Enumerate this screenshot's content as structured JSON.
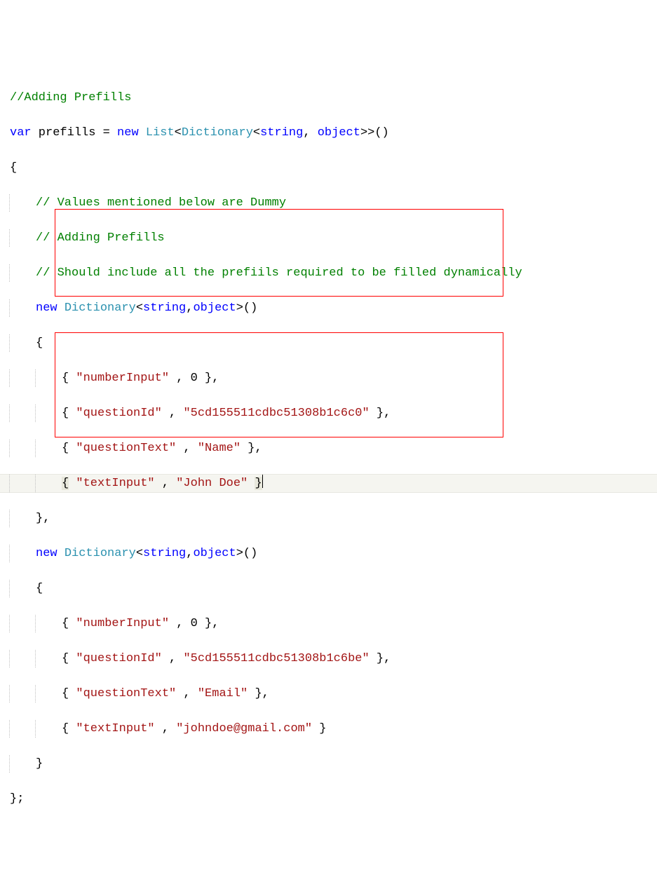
{
  "code": {
    "comment_top": "//Adding Prefills",
    "decl": {
      "var_kw": "var",
      "var_name": " prefills ",
      "eq": "=",
      "new_kw": " new ",
      "list_type": "List",
      "lt1": "<",
      "dict_type": "Dictionary",
      "lt2": "<",
      "string_kw_a": "string",
      "comma_a": ", ",
      "object_kw_a": "object",
      "gt2": ">>()"
    },
    "open_brace": "{",
    "close_brace": "};",
    "inner_comments": [
      "// Values mentioned below are Dummy",
      "// Adding Prefills",
      "// Should include all the prefiils required to be filled dynamically"
    ],
    "dict_ctor": {
      "new_kw": "new ",
      "dict_type": "Dictionary",
      "lt": "<",
      "string_kw": "string",
      "comma": ",",
      "object_kw": "object",
      "gt": ">()"
    },
    "block1": {
      "open": "{",
      "close": "},",
      "rows": [
        {
          "key": "\"numberInput\"",
          "sep": " , ",
          "val": "0",
          "after": " },"
        },
        {
          "key": "\"questionId\"",
          "sep": " , ",
          "val": "\"5cd155511cdbc51308b1c6c0\"",
          "after": " },"
        },
        {
          "key": "\"questionText\"",
          "sep": " , ",
          "val": "\"Name\"",
          "after": " },"
        },
        {
          "key": "\"textInput\"",
          "sep": " , ",
          "val": "\"John Doe\"",
          "after": " }"
        }
      ]
    },
    "block2": {
      "open": "{",
      "close": "}",
      "rows": [
        {
          "key": "\"numberInput\"",
          "sep": " , ",
          "val": "0",
          "after": " },"
        },
        {
          "key": "\"questionId\"",
          "sep": " , ",
          "val": "\"5cd155511cdbc51308b1c6be\"",
          "after": " },"
        },
        {
          "key": "\"questionText\"",
          "sep": " , ",
          "val": "\"Email\"",
          "after": " },"
        },
        {
          "key": "\"textInput\"",
          "sep": " , ",
          "val": "\"johndoe@gmail.com\"",
          "after": " }"
        }
      ]
    }
  }
}
